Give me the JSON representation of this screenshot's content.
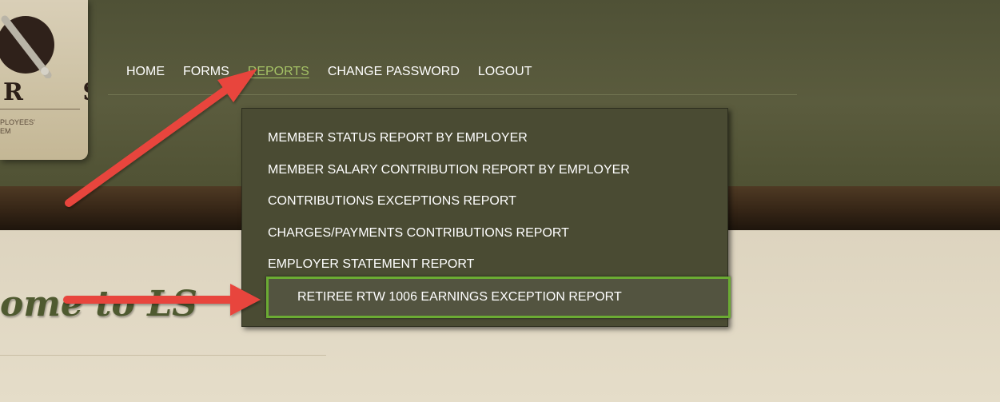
{
  "logo": {
    "letters": "R S",
    "subtext_line1": "PLOYEES'",
    "subtext_line2": "EM"
  },
  "nav": {
    "items": [
      {
        "label": "HOME"
      },
      {
        "label": "FORMS"
      },
      {
        "label": "REPORTS"
      },
      {
        "label": "CHANGE PASSWORD"
      },
      {
        "label": "LOGOUT"
      }
    ],
    "active": "REPORTS"
  },
  "reports_menu": {
    "items": [
      {
        "label": "MEMBER STATUS REPORT BY EMPLOYER"
      },
      {
        "label": "MEMBER SALARY CONTRIBUTION REPORT BY EMPLOYER"
      },
      {
        "label": "CONTRIBUTIONS EXCEPTIONS REPORT"
      },
      {
        "label": "CHARGES/PAYMENTS CONTRIBUTIONS REPORT"
      },
      {
        "label": "EMPLOYER STATEMENT REPORT"
      },
      {
        "label": "RETIREE RTW 1006 EARNINGS EXCEPTION REPORT"
      }
    ],
    "highlighted": "RETIREE RTW 1006 EARNINGS EXCEPTION REPORT"
  },
  "welcome": {
    "text": "ome to LS"
  },
  "colors": {
    "header_bg": "#5b5c3e",
    "nav_active": "#a5c266",
    "dropdown_bg": "#4a4b33",
    "highlight_border": "#6bab33",
    "annotation_arrow": "#e8453c",
    "welcome_text": "#4f5a30"
  }
}
